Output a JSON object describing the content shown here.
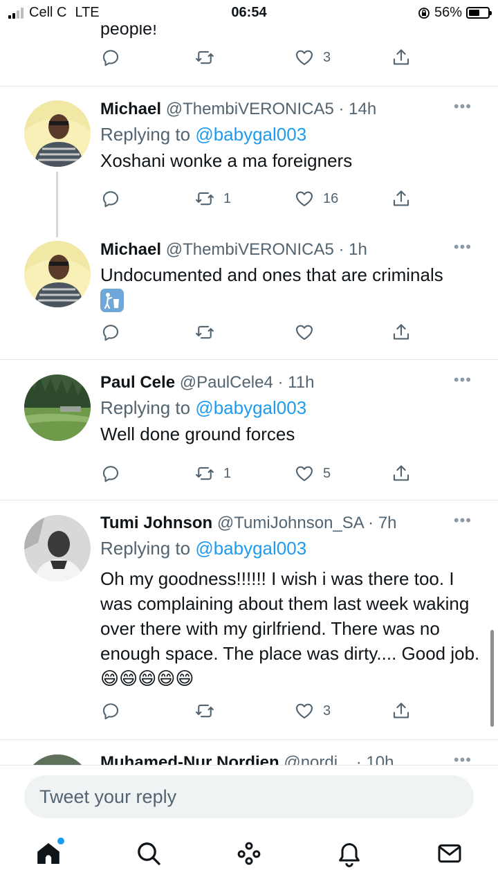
{
  "status_bar": {
    "carrier": "Cell C",
    "network": "LTE",
    "time": "06:54",
    "battery": "56%",
    "battery_level": 0.56
  },
  "previous_tweet": {
    "text_fragment": "people!",
    "like_count": "3"
  },
  "tweets": [
    {
      "name": "Michael",
      "handle": "@ThembiVERONICA5",
      "separator": "·",
      "time": "14h",
      "replying_prefix": "Replying to ",
      "replying_to": "@babygal003",
      "text": "Xoshani wonke a ma foreigners",
      "retweet_count": "1",
      "like_count": "16"
    },
    {
      "name": "Michael",
      "handle": "@ThembiVERONICA5",
      "separator": "·",
      "time": "1h",
      "text": "Undocumented and ones that are criminals",
      "retweet_count": "",
      "like_count": ""
    },
    {
      "name": "Paul Cele",
      "handle": "@PaulCele4",
      "separator": "·",
      "time": "11h",
      "replying_prefix": "Replying to ",
      "replying_to": "@babygal003",
      "text": "Well done ground forces",
      "retweet_count": "1",
      "like_count": "5"
    },
    {
      "name": "Tumi Johnson",
      "handle": "@TumiJohnson_SA",
      "separator": "·",
      "time": "7h",
      "replying_prefix": "Replying to ",
      "replying_to": "@babygal003",
      "text": "Oh my goodness!!!!!! I wish i was there too. I was complaining about them last week waking over there with my girlfriend.  There was no enough space.  The place was dirty.... Good job. 😄😄😄😄😄",
      "retweet_count": "",
      "like_count": "3"
    },
    {
      "name": "Muhamed-Nur Nordien",
      "handle": "@nordi...",
      "separator": "·",
      "time": "10h"
    }
  ],
  "compose": {
    "placeholder": "Tweet your reply"
  },
  "icons": {
    "more": "more-horizontal-icon",
    "reply": "reply-icon",
    "retweet": "retweet-icon",
    "like": "heart-icon",
    "share": "share-icon",
    "tabs": [
      "home-icon",
      "search-icon",
      "spaces-icon",
      "notifications-icon",
      "messages-icon"
    ]
  },
  "colors": {
    "accent": "#1d9bf0",
    "secondary_text": "#536471",
    "divider": "#e3e6e8"
  }
}
